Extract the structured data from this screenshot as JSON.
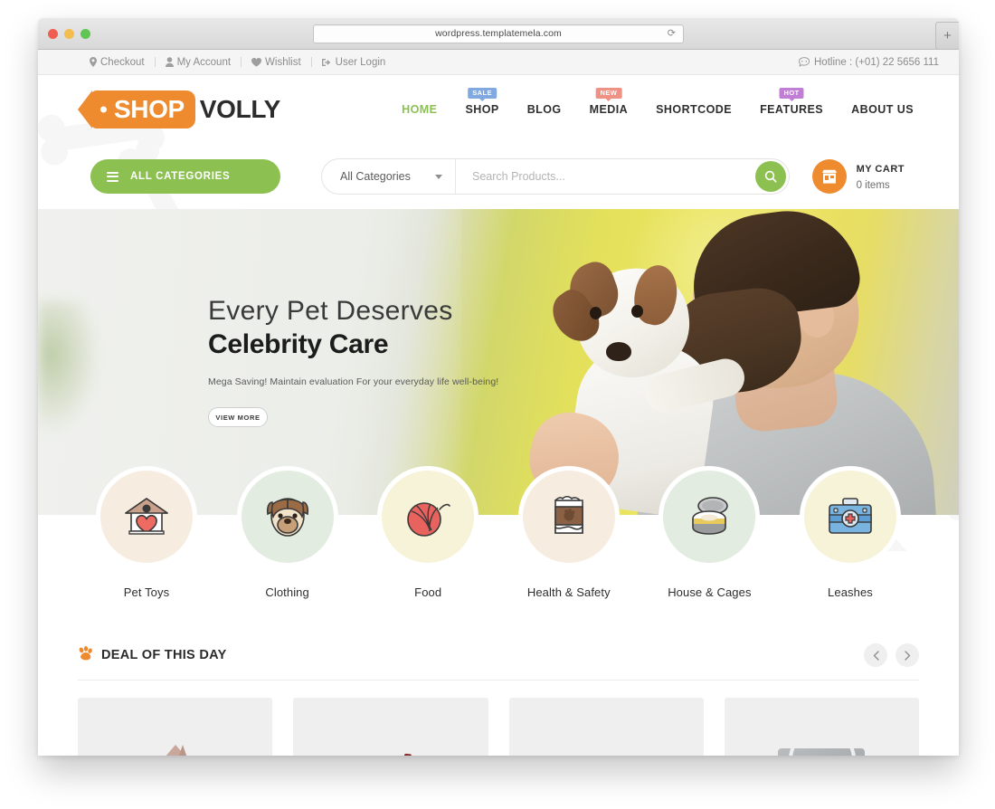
{
  "browser": {
    "url": "wordpress.templatemela.com",
    "reload_icon": "reload-icon",
    "new_tab_label": "+"
  },
  "topbar": {
    "links": [
      {
        "label": "Checkout",
        "icon": "map-pin-icon"
      },
      {
        "label": "My Account",
        "icon": "user-icon"
      },
      {
        "label": "Wishlist",
        "icon": "heart-icon"
      },
      {
        "label": "User Login",
        "icon": "sign-in-icon"
      }
    ],
    "hotline": "Hotline : (+01) 22 5656 111",
    "hotline_icon": "telephone-icon"
  },
  "logo": {
    "shop": "SHOP",
    "volly": "VOLLY"
  },
  "nav": {
    "items": [
      {
        "label": "HOME",
        "active": true,
        "badge": null
      },
      {
        "label": "SHOP",
        "active": false,
        "badge": "SALE"
      },
      {
        "label": "BLOG",
        "active": false,
        "badge": null
      },
      {
        "label": "MEDIA",
        "active": false,
        "badge": "NEW"
      },
      {
        "label": "SHORTCODE",
        "active": false,
        "badge": null
      },
      {
        "label": "FEATURES",
        "active": false,
        "badge": "HOT"
      },
      {
        "label": "ABOUT US",
        "active": false,
        "badge": null
      }
    ]
  },
  "search": {
    "all_categories_button": "ALL CATEGORIES",
    "category_selected": "All Categories",
    "placeholder": "Search Products...",
    "input_value": ""
  },
  "cart": {
    "title": "MY CART",
    "count": "0 items"
  },
  "hero": {
    "line1": "Every Pet Deserves",
    "line2": "Celebrity Care",
    "subtitle": "Mega Saving! Maintain evaluation For your everyday life well-being!",
    "button": "VIEW MORE"
  },
  "categories": [
    {
      "label": "Pet Toys",
      "icon": "dog-house-heart-icon",
      "bg": "#f7ece0"
    },
    {
      "label": "Clothing",
      "icon": "dog-face-icon",
      "bg": "#e3ece0"
    },
    {
      "label": "Food",
      "icon": "yarn-ball-icon",
      "bg": "#f7f3d8"
    },
    {
      "label": "Health & Safety",
      "icon": "food-bag-icon",
      "bg": "#f7ece0"
    },
    {
      "label": "House & Cages",
      "icon": "pet-bowl-icon",
      "bg": "#e3ece0"
    },
    {
      "label": "Leashes",
      "icon": "first-aid-kit-icon",
      "bg": "#f7f3d8"
    }
  ],
  "deal": {
    "title": "DEAL OF THIS DAY",
    "icon": "paw-print-icon",
    "prev_icon": "chevron-left-icon",
    "next_icon": "chevron-right-icon",
    "products": [
      {
        "name": "product-card-1"
      },
      {
        "name": "product-card-2"
      },
      {
        "name": "product-card-3"
      },
      {
        "name": "product-card-4"
      }
    ]
  },
  "colors": {
    "brand_orange": "#ee8b2f",
    "brand_green": "#8cc152",
    "nav_active": "#8cc152",
    "badge_sale": "#7fa9e0",
    "badge_new": "#ef9184",
    "badge_hot": "#c07fd4"
  }
}
